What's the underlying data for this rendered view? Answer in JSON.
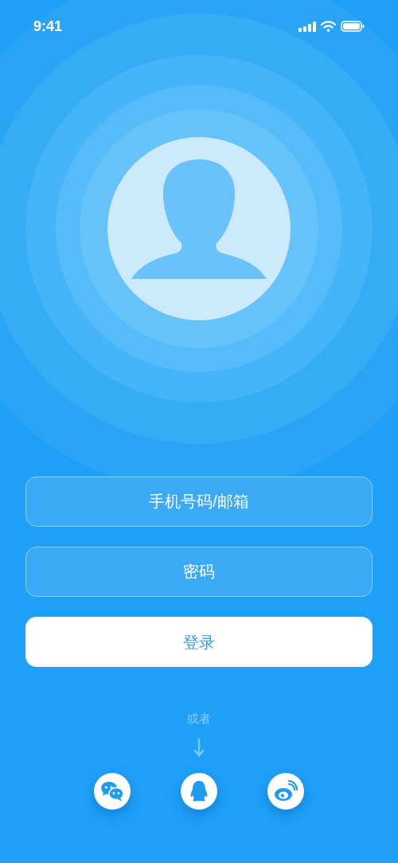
{
  "status_bar": {
    "time": "9:41"
  },
  "fields": [
    {
      "placeholder": "手机号码/邮箱"
    },
    {
      "placeholder": "密码"
    }
  ],
  "login_button": "登录",
  "divider_text": "或者",
  "social": [
    {
      "kind": "wechat"
    },
    {
      "kind": "qq"
    },
    {
      "kind": "weibo"
    }
  ]
}
